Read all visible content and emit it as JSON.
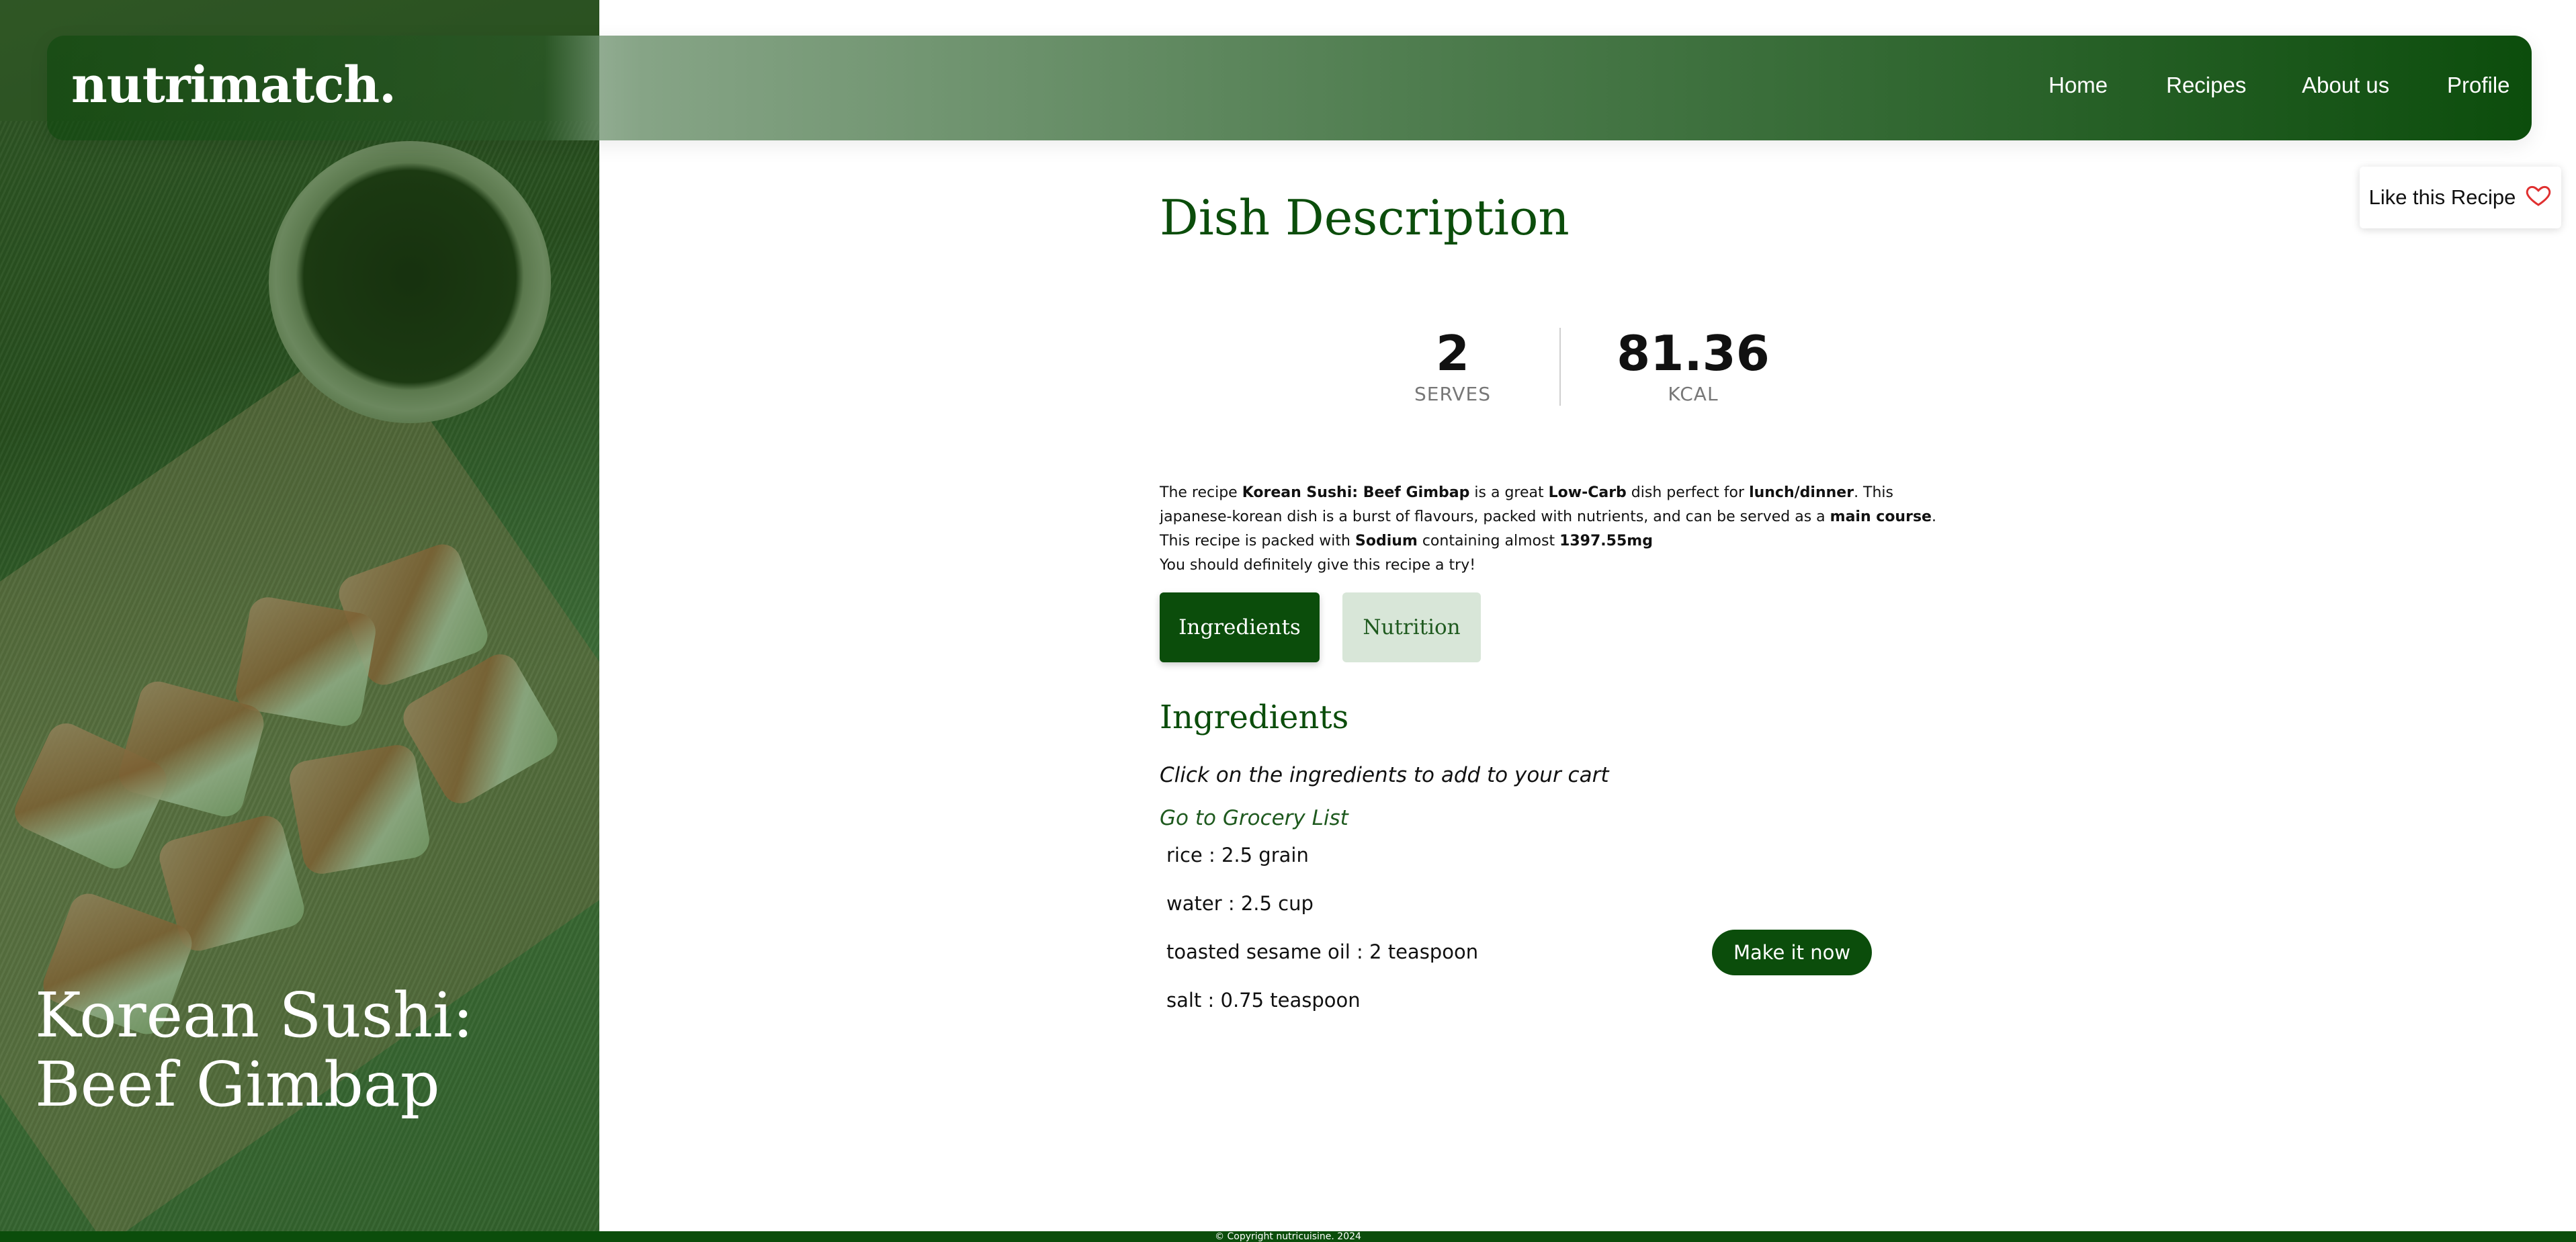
{
  "brand": {
    "logo": "nutrimatch."
  },
  "nav": {
    "items": [
      {
        "label": "Home"
      },
      {
        "label": "Recipes"
      },
      {
        "label": "About us"
      },
      {
        "label": "Profile"
      }
    ]
  },
  "hero": {
    "title_line1": "Korean Sushi:",
    "title_line2": "Beef Gimbap"
  },
  "like": {
    "label": "Like this Recipe",
    "icon": "heart-icon",
    "icon_color": "#e03030"
  },
  "main": {
    "title": "Dish Description",
    "stats": {
      "serves_value": "2",
      "serves_label": "SERVES",
      "kcal_value": "81.36",
      "kcal_label": "KCAL"
    },
    "description": {
      "t1": "The recipe ",
      "recipe_name": "Korean Sushi: Beef Gimbap",
      "t2": " is a great ",
      "diet": "Low-Carb",
      "t3": " dish perfect for ",
      "meal": "lunch/dinner",
      "t4": ". This japanese-korean dish is a burst of flavours, packed with nutrients, and can be served as a ",
      "course": "main course",
      "t5": ". This recipe is packed with ",
      "nutrient": "Sodium",
      "t6": " containing almost ",
      "amount": "1397.55mg",
      "closing": "You should definitely give this recipe a try!"
    },
    "tabs": [
      {
        "label": "Ingredients",
        "active": true
      },
      {
        "label": "Nutrition",
        "active": false
      }
    ],
    "section_title": "Ingredients",
    "hint": "Click on the ingredients to add to your cart",
    "grocery_link": "Go to Grocery List",
    "ingredients": [
      {
        "text": "rice : 2.5 grain"
      },
      {
        "text": "water : 2.5 cup"
      },
      {
        "text": "toasted sesame oil : 2 teaspoon"
      },
      {
        "text": "salt : 0.75 teaspoon"
      }
    ],
    "make_button": "Make it now"
  },
  "footer": {
    "text": "© Copyright nutricuisine. 2024"
  },
  "colors": {
    "primary": "#0b4d0b",
    "tab_inactive_bg": "#d8e6d8"
  }
}
